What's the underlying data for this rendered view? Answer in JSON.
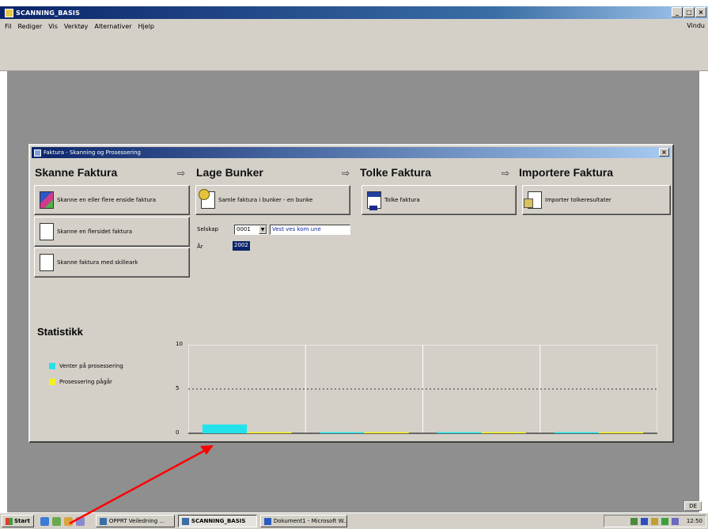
{
  "app": {
    "title": "SCANNING_BASIS",
    "menu": [
      "Fil",
      "Rediger",
      "Vis",
      "Verktøy",
      "Alternativer",
      "Hjelp"
    ],
    "window_menu": "Vindu",
    "minimize": "_",
    "maximize": "□",
    "close": "×"
  },
  "dialog": {
    "title": "Faktura - Skanning og Prosessering",
    "close": "×",
    "sections": {
      "skanne": "Skanne Faktura",
      "lage": "Lage Bunker",
      "tolke": "Tolke Faktura",
      "importere": "Importere Faktura"
    },
    "arrow": "⇨",
    "buttons": {
      "skann_flere": "Skanne en eller flere enside faktura",
      "skann_flersidet": "Skanne en flersidet faktura",
      "skann_skilleark": "Skanne faktura med skilleark",
      "samle": "Samle faktura i bunker - en bunke",
      "tolke": "Tolke faktura",
      "importer": "Importer tolkeresultater"
    },
    "form": {
      "selskap_label": "Selskap",
      "selskap_value": "0001",
      "selskap_name": "Vest ves kom une",
      "ar_label": "År",
      "ar_value": "2002"
    },
    "statistikk": {
      "title": "Statistikk",
      "legend": [
        {
          "label": "Venter på prosessering",
          "color": "#22e3ea"
        },
        {
          "label": "Prosessering pågår",
          "color": "#f4f21a"
        }
      ]
    }
  },
  "chart_data": {
    "type": "bar",
    "categories": [
      "Skanne Faktura",
      "Lage Bunker",
      "Tolke Faktura",
      "Importere Faktura"
    ],
    "series": [
      {
        "name": "Venter på prosessering",
        "color": "#22e3ea",
        "values": [
          1,
          0,
          0,
          0
        ]
      },
      {
        "name": "Prosessering pågår",
        "color": "#f4f21a",
        "values": [
          0,
          0,
          0,
          0
        ]
      }
    ],
    "yticks": [
      "10",
      "5",
      "0"
    ],
    "ylim": [
      0,
      10
    ],
    "reference_line": 5,
    "grid": true
  },
  "taskbar": {
    "start": "Start",
    "tasks": [
      {
        "label": "OPPRT Veiledning ...",
        "active": false
      },
      {
        "label": "SCANNING_BASIS",
        "active": true
      },
      {
        "label": "Dokument1 - Microsoft W...",
        "active": false
      }
    ],
    "clock": "12:50",
    "lang": "DE"
  }
}
